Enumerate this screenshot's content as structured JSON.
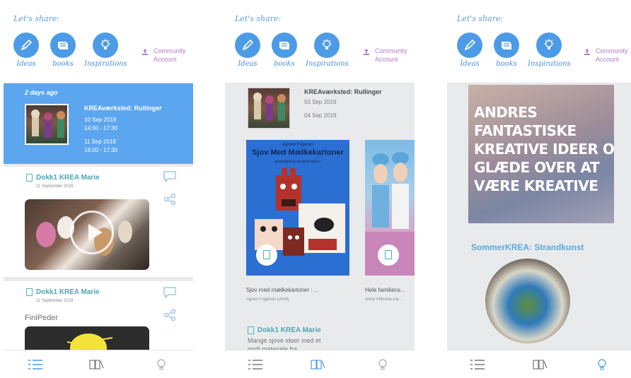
{
  "header": {
    "lets_share": "Let's share:",
    "categories": [
      {
        "label": "Ideas",
        "icon": "pencil-icon"
      },
      {
        "label": "books",
        "icon": "book-icon"
      },
      {
        "label": "Inspirations",
        "icon": "lightbulb-icon"
      }
    ],
    "community_line1": "Community",
    "community_line2": "Account"
  },
  "screen1": {
    "event": {
      "ago": "2 days ago",
      "title": "KREAværksted: Rullinger",
      "date1": "10 Sep 2019",
      "time1": "14:00 - 17:30",
      "date2": "11 Sep 2019",
      "time2": "16:00 - 17:30"
    },
    "post1": {
      "author": "Dokk1 KREA Marie",
      "date": "11 September 2019"
    },
    "post2": {
      "author": "Dokk1 KREA Marie",
      "date": "11 September 2019",
      "caption": "FiniPeder"
    }
  },
  "screen2": {
    "event": {
      "title": "KREAværksted: Rullinger",
      "date1": "03 Sep 2019",
      "date2": "04 Sep 2019"
    },
    "books": [
      {
        "cover_author": "Agnete Fogenes",
        "cover_title": "Sjov Med Mælkekartoner",
        "cover_subtitle": "genbrugsting og sjove figurer",
        "name": "Sjov med mælkekartoner : ...",
        "author": "Agnes Fogenes (2006)"
      },
      {
        "name": "Hele familiens...",
        "author": "Anne Vittorina Ga..."
      }
    ],
    "post": {
      "author": "Dokk1 KREA Marie",
      "text1": "Mange sjove ideer med et",
      "text2": "godt materiale fra"
    }
  },
  "screen3": {
    "inspiration": {
      "lines": [
        "ANDRES",
        "FANTASTISKE",
        "KREATIVE IDEER OG",
        "GLÆDE OVER AT",
        "VÆRE KREATIVE"
      ]
    },
    "title": "SommerKREA: Strandkunst"
  },
  "tabbar": {
    "icons": [
      "list-icon",
      "books-icon",
      "lightbulb-icon"
    ]
  },
  "colors": {
    "accent_blue": "#4c9be6",
    "teal": "#4aa7b3",
    "community_purple": "#b37ac8",
    "selected_band": "#5ca6ef"
  }
}
